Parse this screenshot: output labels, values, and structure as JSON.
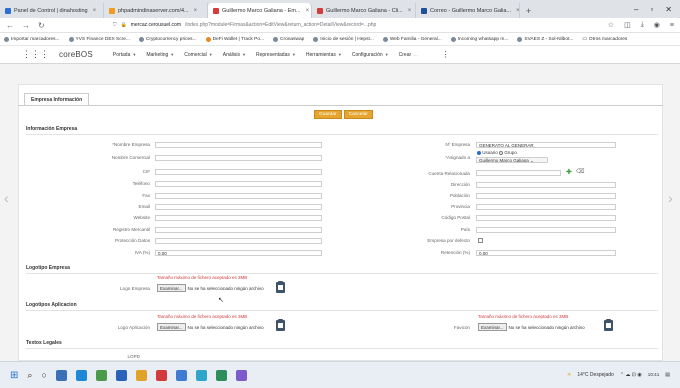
{
  "browser": {
    "tabs": [
      {
        "label": "Panel de Control | dinahosting",
        "color": "#2b6fd6"
      },
      {
        "label": "phpadmindinaserver.com/4...",
        "color": "#f29a1b"
      },
      {
        "label": "Guillermo Marco Galiana - Em...",
        "color": "#d43b3b"
      },
      {
        "label": "Guillermo Marco Galiana - Cli...",
        "color": "#d43b3b"
      },
      {
        "label": "Correo - Guillermo Marco Galia...",
        "color": "#1f4e9c"
      }
    ],
    "new_tab": "+",
    "url_host": "mercaz.cerousuel.com",
    "url_path": "/index.php?module=Firmas&action=EditView&return_action=DetailView&record=...php",
    "bookmarks": [
      "Importar marcadores...",
      "YVS Finance DEX Scre...",
      "Cryptocurrency prices...",
      "DeFi Wallet | Track Po...",
      "Cronaswap",
      "Inicio de sesión | Hepst...",
      "Web Familia - General...",
      "Incoming whatsapp m...",
      "SVAES Z - Sol-Nilbot...",
      "Otros marcadores"
    ]
  },
  "app": {
    "brand": "coreBOS",
    "menu": [
      "Portada",
      "Marketing",
      "Comercial",
      "Análisis",
      "Representadas",
      "Herramientas",
      "Configuración",
      "Crear"
    ]
  },
  "form": {
    "tab_label": "Empresa Información",
    "save_label": "Guardar",
    "cancel_label": "Cancelar",
    "sections": {
      "info": "Información Empresa",
      "logo": "Logotipo Empresa",
      "logo_app": "Logotipos Aplicacion",
      "legal": "Textos Legales"
    },
    "left_fields": [
      {
        "label": "*Nombre Empresa",
        "value": ""
      },
      {
        "label": "Nombre Comercial",
        "value": ""
      },
      {
        "label": "CIF",
        "value": ""
      },
      {
        "label": "Teléfono",
        "value": ""
      },
      {
        "label": "Fax",
        "value": ""
      },
      {
        "label": "Email",
        "value": ""
      },
      {
        "label": "Website",
        "value": ""
      },
      {
        "label": "Registro Mercantil",
        "value": ""
      },
      {
        "label": "Protección Datos",
        "value": ""
      },
      {
        "label": "IVA (%)",
        "value": "0.00"
      }
    ],
    "right_fields": {
      "num_empresa_label": "Nº Empresa",
      "num_empresa_value": "GENERATO AL GENERAR",
      "asignado_label": "*Asignado a",
      "usuario": "Usuario",
      "grupo": "Grupo",
      "asignado_value": "Guillermo Marco Galiana",
      "cuenta_label": "Cuenta Relacionada",
      "direccion": "Dirección",
      "poblacion": "Población",
      "provincia": "Provincia",
      "cp": "Código Postal",
      "pais": "País",
      "defecto": "Empresa por defecto",
      "retencion_label": "Retención (%)",
      "retencion_value": "0.00"
    },
    "file_warning": "Tamaño máximo de fichero aceptado es 3MB",
    "browse_label": "Examinar...",
    "no_file": "No se ha seleccionado ningún archivo",
    "logo_empresa_label": "Logo Empresa",
    "logo_app_label": "Logo Aplicación",
    "favicon_label": "Favicon",
    "lopd_label": "LOPD"
  },
  "taskbar": {
    "weather": "14°C Despejado",
    "time": "10:41"
  }
}
